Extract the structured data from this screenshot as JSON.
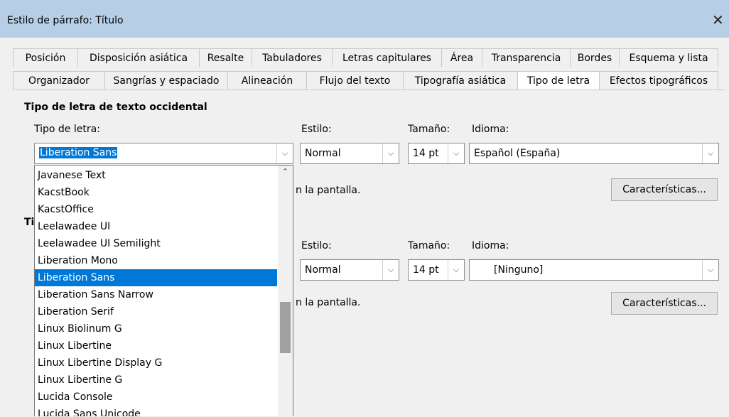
{
  "window": {
    "title": "Estilo de párrafo: Título"
  },
  "tabs_row1": [
    "Posición",
    "Disposición asiática",
    "Resalte",
    "Tabuladores",
    "Letras capitulares",
    "Área",
    "Transparencia",
    "Bordes",
    "Esquema y lista"
  ],
  "tabs_row2": [
    "Organizador",
    "Sangrías y espaciado",
    "Alineación",
    "Flujo del texto",
    "Tipografía asiática",
    "Tipo de letra",
    "Efectos tipográficos"
  ],
  "active_tab": "Tipo de letra",
  "western": {
    "section_title": "Tipo de letra de texto occidental",
    "font_label": "Tipo de letra:",
    "style_label": "Estilo:",
    "size_label": "Tamaño:",
    "lang_label": "Idioma:",
    "font_value": "Liberation Sans",
    "style_value": "Normal",
    "size_value": "14 pt",
    "lang_value": "Español (España)",
    "note_fragment": "n la pantalla.",
    "features_button": "Características..."
  },
  "asian": {
    "section_title_fragment": "Ti",
    "style_label": "Estilo:",
    "size_label": "Tamaño:",
    "lang_label": "Idioma:",
    "style_value": "Normal",
    "size_value": "14 pt",
    "lang_value": "[Ninguno]",
    "note_fragment": "n la pantalla.",
    "features_button": "Características..."
  },
  "font_dropdown": {
    "items": [
      "Javanese Text",
      "KacstBook",
      "KacstOffice",
      "Leelawadee UI",
      "Leelawadee UI Semilight",
      "Liberation Mono",
      "Liberation Sans",
      "Liberation Sans Narrow",
      "Liberation Serif",
      "Linux Biolinum G",
      "Linux Libertine",
      "Linux Libertine Display G",
      "Linux Libertine G",
      "Lucida Console",
      "Lucida Sans Unicode"
    ],
    "selected": "Liberation Sans"
  },
  "icons": {
    "close": "close-icon",
    "chevron": "chevron-down-icon",
    "scroll_up": "chevron-up-icon"
  },
  "colors": {
    "titlebar": "#b6cfe6",
    "selection": "#0078d7",
    "active_tab_underline": "#e8141c"
  }
}
